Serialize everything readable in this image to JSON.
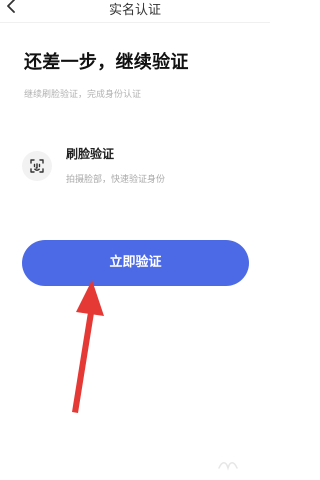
{
  "header": {
    "title": "实名认证"
  },
  "main": {
    "heading": "还差一步，继续验证",
    "subtext": "继续刷脸验证，完成身份认证",
    "feature": {
      "title": "刷脸验证",
      "description": "拍摄脸部，快速验证身份"
    },
    "cta": {
      "label": "立即验证"
    }
  },
  "colors": {
    "accent": "#4d6ae6",
    "arrow": "#e53935"
  }
}
